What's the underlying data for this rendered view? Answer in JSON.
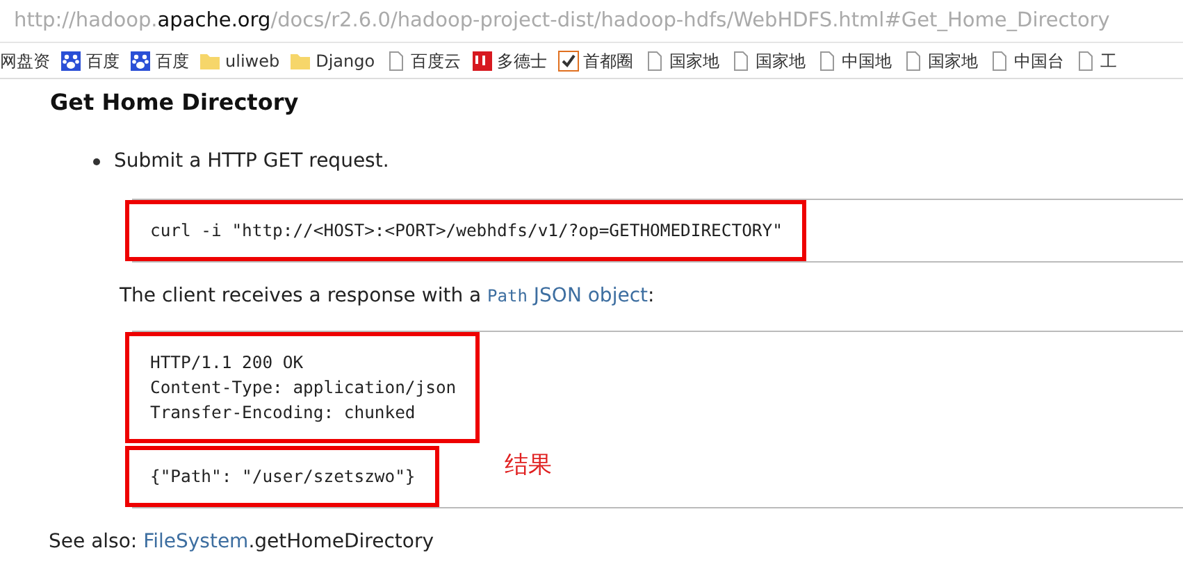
{
  "address_bar": {
    "url_prefix": "http://hadoop.",
    "url_domain": "apache.org",
    "url_rest": "/docs/r2.6.0/hadoop-project-dist/hadoop-hdfs/WebHDFS.html#Get_Home_Directory"
  },
  "bookmarks": [
    {
      "kind": "none",
      "label": "网盘资"
    },
    {
      "kind": "paw",
      "label": "百度"
    },
    {
      "kind": "paw",
      "label": "百度"
    },
    {
      "kind": "folder",
      "label": "uliweb"
    },
    {
      "kind": "folder",
      "label": "Django"
    },
    {
      "kind": "page",
      "label": "百度云"
    },
    {
      "kind": "jd",
      "label": "多德士"
    },
    {
      "kind": "custom",
      "label": "首都圈"
    },
    {
      "kind": "page",
      "label": "国家地"
    },
    {
      "kind": "page",
      "label": "国家地"
    },
    {
      "kind": "page",
      "label": "中国地"
    },
    {
      "kind": "page",
      "label": "国家地"
    },
    {
      "kind": "page",
      "label": "中国台"
    },
    {
      "kind": "page",
      "label": "工"
    }
  ],
  "heading": "Get Home Directory",
  "bullet": "Submit a HTTP GET request.",
  "request": {
    "highlighted": true,
    "lines": [
      "curl -i \"http://<HOST>:<PORT>/webhdfs/v1/?op=GETHOMEDIRECTORY\""
    ]
  },
  "response_intro": {
    "before": "The client receives a response with a ",
    "code_link": "Path",
    "link": "JSON object",
    "after": ":"
  },
  "response": {
    "blocks": [
      {
        "highlighted": true,
        "lines": [
          "HTTP/1.1 200 OK",
          "Content-Type: application/json",
          "Transfer-Encoding: chunked"
        ]
      },
      {
        "highlighted": true,
        "lines": [
          "{\"Path\": \"/user/szetszwo\"}"
        ]
      }
    ],
    "annotation": "结果"
  },
  "see_also": {
    "label": "See also: ",
    "link": "FileSystem",
    "rest": ".getHomeDirectory"
  }
}
